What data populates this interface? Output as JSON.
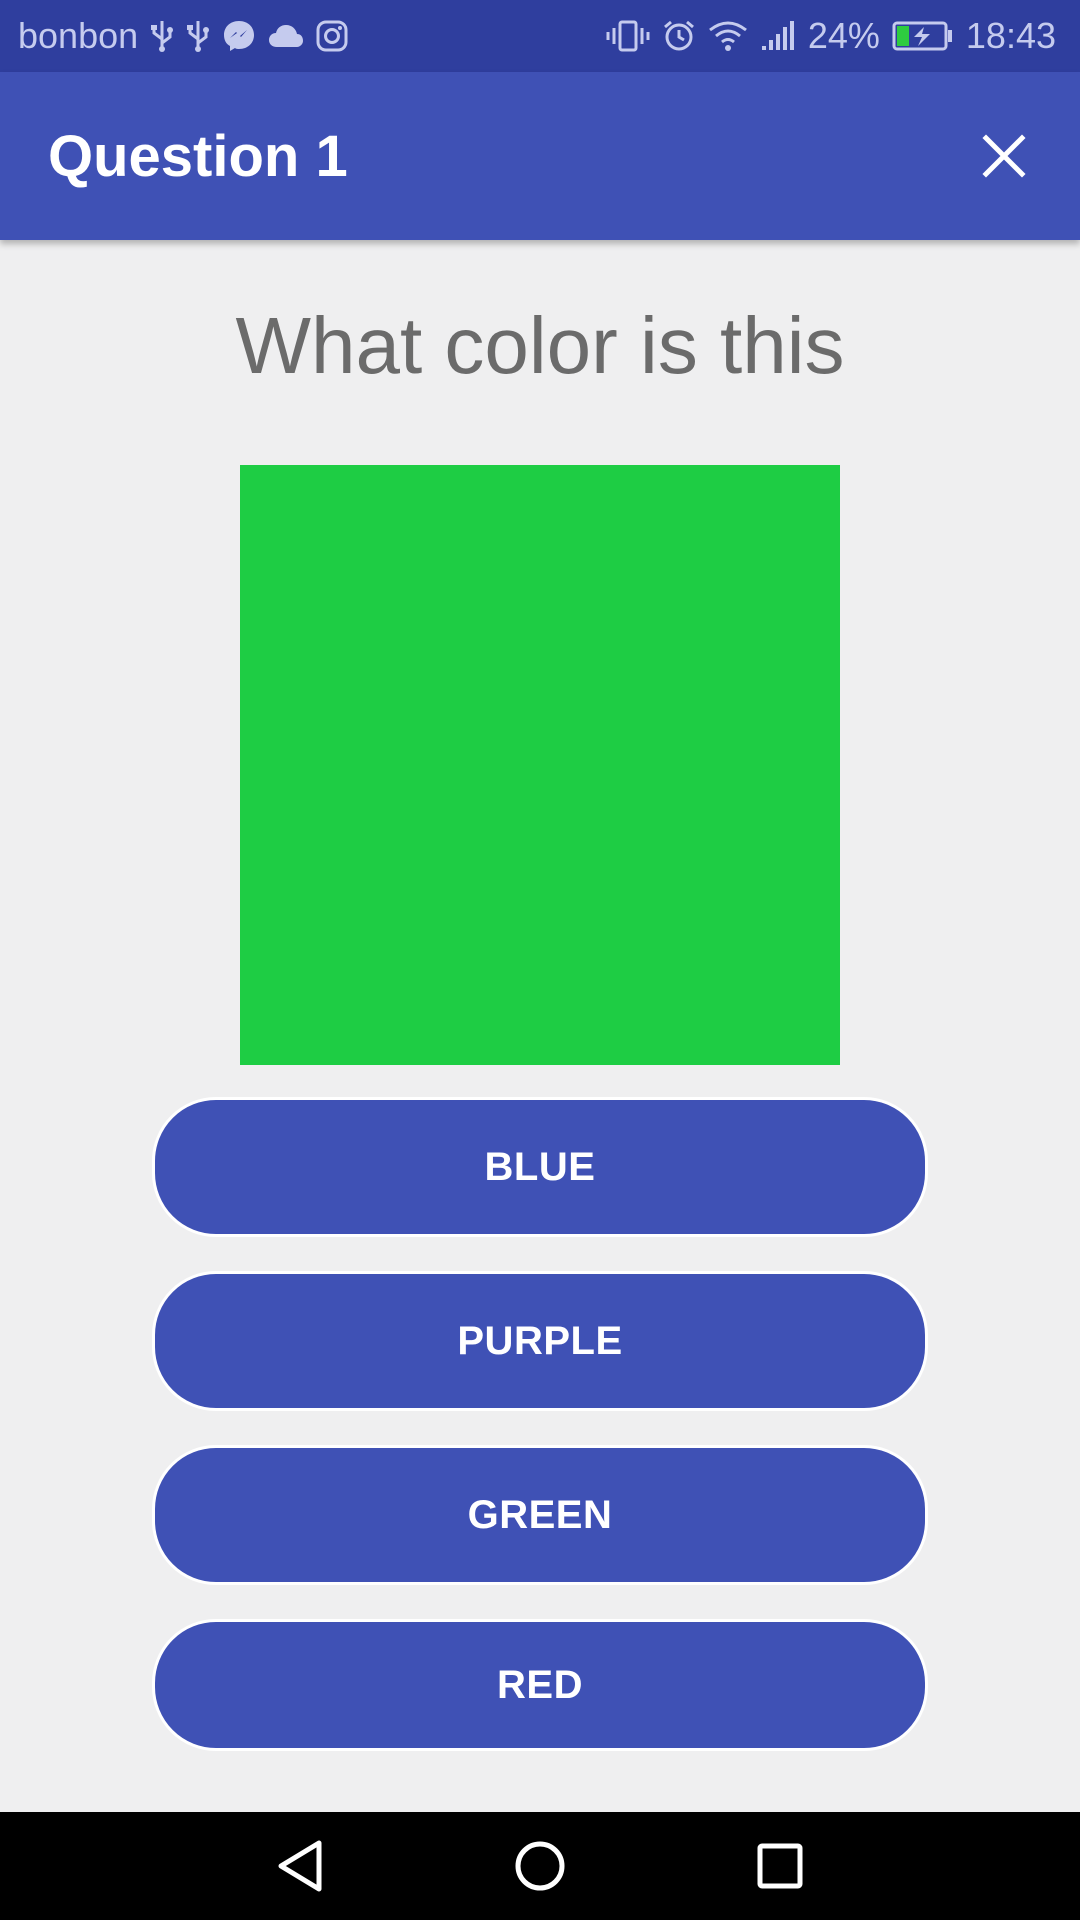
{
  "status_bar": {
    "carrier": "bonbon",
    "battery_percent": "24%",
    "time": "18:43",
    "left_icons": [
      "usb-icon",
      "usb-icon",
      "messenger-icon",
      "cloud-icon",
      "instagram-icon"
    ],
    "right_icons": [
      "vibrate-icon",
      "alarm-icon",
      "wifi-icon",
      "signal-icon",
      "battery-charging-icon"
    ]
  },
  "app_bar": {
    "title": "Question 1",
    "close_icon": "close-icon"
  },
  "question": {
    "text": "What color is this",
    "swatch_color": "#1ecd44"
  },
  "answers": [
    {
      "label": "BLUE"
    },
    {
      "label": "PURPLE"
    },
    {
      "label": "GREEN"
    },
    {
      "label": "RED"
    }
  ],
  "nav_bar": {
    "buttons": [
      "back-icon",
      "home-icon",
      "recents-icon"
    ]
  },
  "colors": {
    "primary": "#3f51b5",
    "primary_dark": "#2f3e9e",
    "background": "#efeff0",
    "question_text": "#6b6b6b"
  }
}
